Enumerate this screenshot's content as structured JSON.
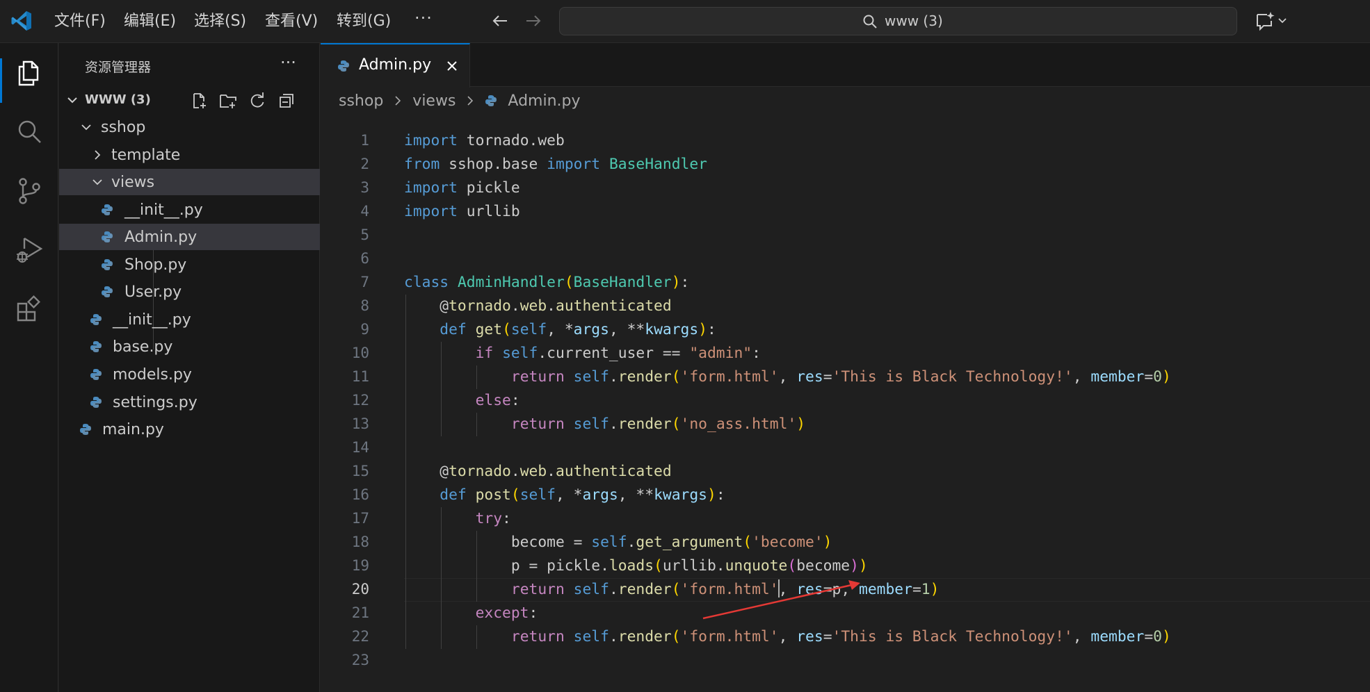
{
  "titlebar": {
    "menus": [
      "文件(F)",
      "编辑(E)",
      "选择(S)",
      "查看(V)",
      "转到(G)"
    ],
    "more": "···",
    "search_text": "www (3)"
  },
  "sidebar": {
    "title": "资源管理器",
    "more": "···",
    "workspace": "WWW (3)",
    "tree": [
      {
        "label": "sshop",
        "type": "folder",
        "expanded": true,
        "depth": 1
      },
      {
        "label": "template",
        "type": "folder",
        "expanded": false,
        "depth": 2
      },
      {
        "label": "views",
        "type": "folder",
        "expanded": true,
        "depth": 2
      },
      {
        "label": "__init__.py",
        "type": "py",
        "depth": 3
      },
      {
        "label": "Admin.py",
        "type": "py",
        "depth": 3,
        "selected": true
      },
      {
        "label": "Shop.py",
        "type": "py",
        "depth": 3
      },
      {
        "label": "User.py",
        "type": "py",
        "depth": 3
      },
      {
        "label": "__init__.py",
        "type": "py",
        "depth": 2
      },
      {
        "label": "base.py",
        "type": "py",
        "depth": 2
      },
      {
        "label": "models.py",
        "type": "py",
        "depth": 2
      },
      {
        "label": "settings.py",
        "type": "py",
        "depth": 2
      },
      {
        "label": "main.py",
        "type": "py",
        "depth": 1
      }
    ]
  },
  "editor": {
    "tab_label": "Admin.py",
    "breadcrumb": [
      "sshop",
      "views",
      "Admin.py"
    ],
    "current_line": 20,
    "lines": [
      "import tornado.web",
      "from sshop.base import BaseHandler",
      "import pickle",
      "import urllib",
      "",
      "",
      "class AdminHandler(BaseHandler):",
      "    @tornado.web.authenticated",
      "    def get(self, *args, **kwargs):",
      "        if self.current_user == \"admin\":",
      "            return self.render('form.html', res='This is Black Technology!', member=0)",
      "        else:",
      "            return self.render('no_ass.html')",
      "",
      "    @tornado.web.authenticated",
      "    def post(self, *args, **kwargs):",
      "        try:",
      "            become = self.get_argument('become')",
      "            p = pickle.loads(urllib.unquote(become))",
      "            return self.render('form.html', res=p, member=1)",
      "        except:",
      "            return self.render('form.html', res='This is Black Technology!', member=0)",
      ""
    ]
  },
  "colors": {
    "accent": "#0078d4",
    "annotation_arrow": "#e53935",
    "keyword": "#569cd6",
    "control": "#c586c0",
    "class": "#4ec9b0",
    "function": "#dcdcaa",
    "string": "#ce9178",
    "number": "#b5cea8",
    "variable": "#9cdcfe"
  },
  "icons": {
    "activity": [
      "explorer-icon",
      "search-icon",
      "source-control-icon",
      "run-debug-icon",
      "extensions-icon"
    ]
  }
}
